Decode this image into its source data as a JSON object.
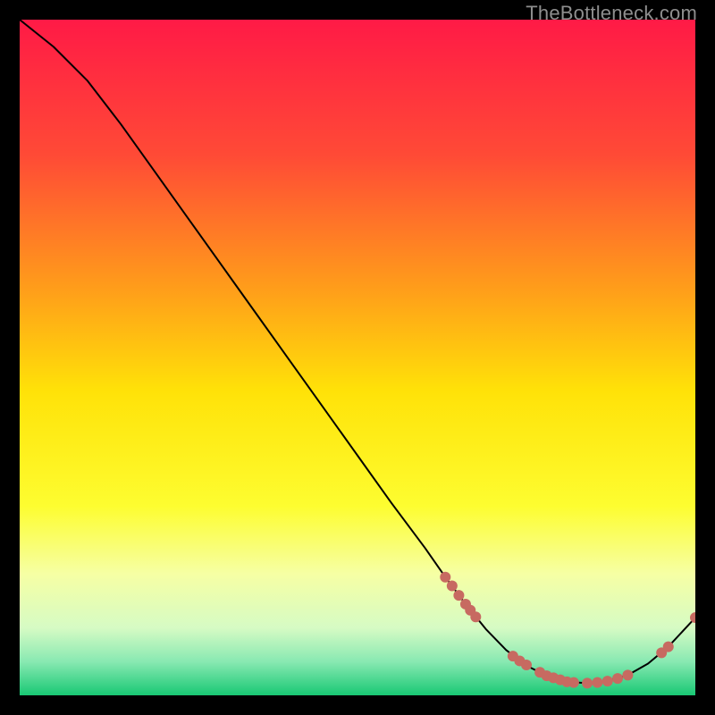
{
  "watermark": "TheBottleneck.com",
  "chart_data": {
    "type": "line",
    "title": "",
    "xlabel": "",
    "ylabel": "",
    "xlim": [
      0,
      100
    ],
    "ylim": [
      0,
      100
    ],
    "grid": false,
    "legend": false,
    "background": {
      "kind": "vertical-gradient",
      "stops": [
        {
          "pos": 0.0,
          "color": "#ff1a46"
        },
        {
          "pos": 0.2,
          "color": "#ff4a36"
        },
        {
          "pos": 0.4,
          "color": "#ff9e1a"
        },
        {
          "pos": 0.55,
          "color": "#ffe208"
        },
        {
          "pos": 0.72,
          "color": "#fdfd30"
        },
        {
          "pos": 0.82,
          "color": "#f6ffa4"
        },
        {
          "pos": 0.9,
          "color": "#d6fbc4"
        },
        {
          "pos": 0.95,
          "color": "#89e9b2"
        },
        {
          "pos": 1.0,
          "color": "#18c874"
        }
      ]
    },
    "series": [
      {
        "name": "bottleneck-curve",
        "x": [
          0,
          5,
          10,
          15,
          20,
          25,
          30,
          35,
          40,
          45,
          50,
          55,
          60,
          63,
          66,
          69,
          72,
          75,
          78,
          81,
          84,
          87,
          90,
          93,
          96,
          100
        ],
        "y": [
          100,
          96,
          91,
          84.5,
          77.5,
          70.5,
          63.5,
          56.5,
          49.5,
          42.5,
          35.5,
          28.5,
          21.8,
          17.5,
          13.5,
          9.8,
          6.7,
          4.4,
          2.9,
          2.0,
          1.8,
          2.1,
          3.0,
          4.7,
          7.2,
          11.5
        ],
        "stroke": "#000000",
        "stroke_width": 2
      }
    ],
    "markers": {
      "name": "highlight-dots",
      "color": "#c76a61",
      "radius": 6,
      "points": [
        {
          "x": 63.0,
          "y": 17.5
        },
        {
          "x": 64.0,
          "y": 16.2
        },
        {
          "x": 65.0,
          "y": 14.8
        },
        {
          "x": 66.0,
          "y": 13.5
        },
        {
          "x": 66.7,
          "y": 12.6
        },
        {
          "x": 67.5,
          "y": 11.6
        },
        {
          "x": 73.0,
          "y": 5.8
        },
        {
          "x": 74.0,
          "y": 5.1
        },
        {
          "x": 75.0,
          "y": 4.5
        },
        {
          "x": 77.0,
          "y": 3.4
        },
        {
          "x": 78.0,
          "y": 2.9
        },
        {
          "x": 79.0,
          "y": 2.6
        },
        {
          "x": 80.0,
          "y": 2.3
        },
        {
          "x": 81.0,
          "y": 2.0
        },
        {
          "x": 82.0,
          "y": 1.9
        },
        {
          "x": 84.0,
          "y": 1.8
        },
        {
          "x": 85.5,
          "y": 1.9
        },
        {
          "x": 87.0,
          "y": 2.1
        },
        {
          "x": 88.5,
          "y": 2.5
        },
        {
          "x": 90.0,
          "y": 3.0
        },
        {
          "x": 95.0,
          "y": 6.3
        },
        {
          "x": 96.0,
          "y": 7.2
        },
        {
          "x": 100.0,
          "y": 11.5
        }
      ]
    }
  }
}
